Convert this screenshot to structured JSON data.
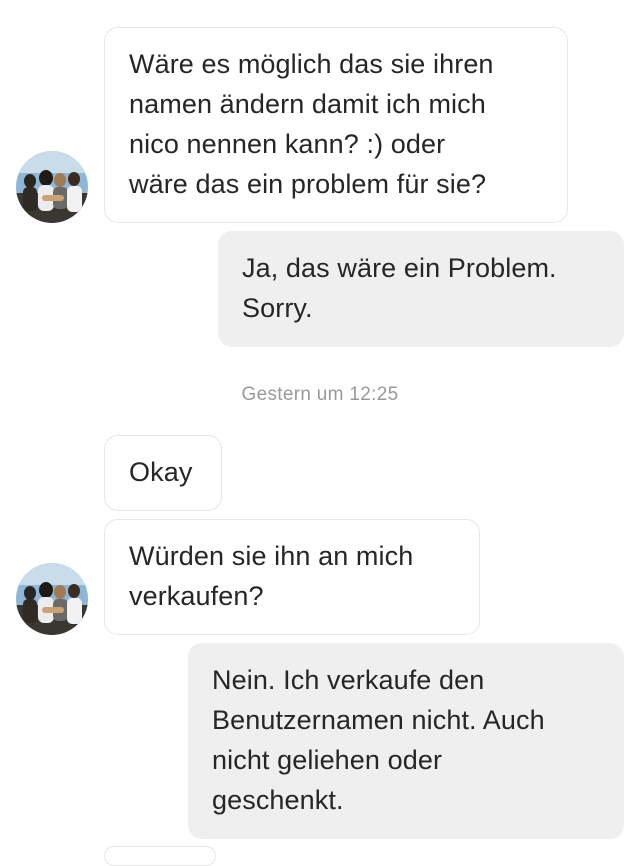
{
  "conversation": {
    "messages": [
      {
        "direction": "incoming",
        "lines": [
          "Wäre es möglich das sie ihren",
          "namen ändern damit ich mich",
          "nico nennen kann? :) oder",
          "wäre das ein problem für sie?"
        ]
      },
      {
        "direction": "outgoing",
        "lines": [
          "Ja, das wäre ein Problem.",
          "Sorry."
        ]
      },
      {
        "direction": "incoming",
        "lines": [
          "Okay"
        ]
      },
      {
        "direction": "incoming",
        "lines": [
          "Würden sie ihn an mich",
          "verkaufen?"
        ]
      },
      {
        "direction": "outgoing",
        "lines": [
          "Nein. Ich verkaufe den",
          "Benutzernamen nicht. Auch",
          "nicht geliehen oder",
          "geschenkt."
        ]
      }
    ],
    "timestamp": "Gestern um 12:25"
  },
  "colors": {
    "incoming_bubble": "#ffffff",
    "incoming_border": "#e6e6e6",
    "outgoing_bubble": "#efefef",
    "text": "#262626",
    "timestamp": "#999999"
  },
  "icons": {
    "avatar": "profile-photo-group-of-people"
  }
}
